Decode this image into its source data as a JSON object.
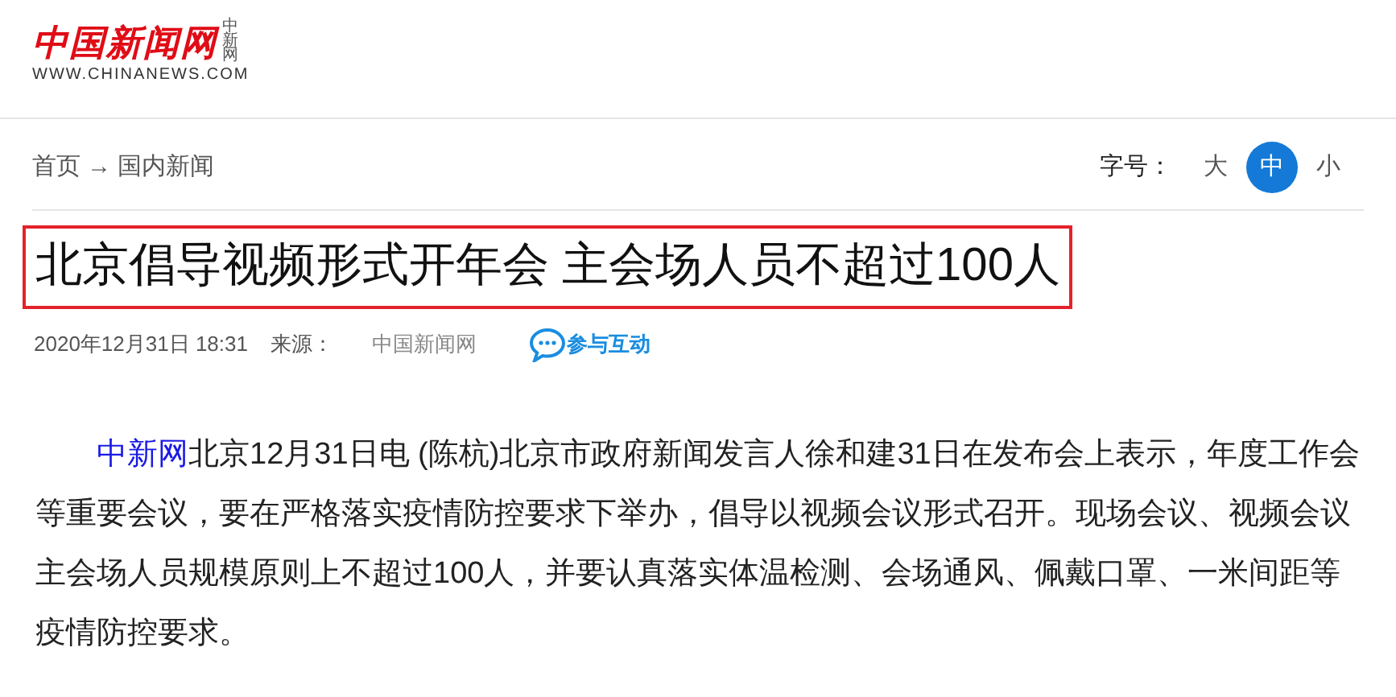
{
  "logo": {
    "name": "中国新闻网",
    "side_text": "中新网",
    "url": "WWW.CHINANEWS.COM"
  },
  "breadcrumb": {
    "home": "首页",
    "separator": "→",
    "section": "国内新闻"
  },
  "font_size": {
    "label": "字号：",
    "options": [
      {
        "label": "大",
        "selected": false
      },
      {
        "label": "中",
        "selected": true
      },
      {
        "label": "小",
        "selected": false
      }
    ]
  },
  "headline": "北京倡导视频形式开年会 主会场人员不超过100人",
  "meta": {
    "date": "2020年12月31日 18:31",
    "source_label": "来源：",
    "source": "中国新闻网",
    "interact": "参与互动"
  },
  "article": {
    "source_link": "中新网",
    "text": "北京12月31日电 (陈杭)北京市政府新闻发言人徐和建31日在发布会上表示，年度工作会等重要会议，要在严格落实疫情防控要求下举办，倡导以视频会议形式召开。现场会议、视频会议主会场人员规模原则上不超过100人，并要认真落实体温检测、会场通风、佩戴口罩、一米间距等疫情防控要求。"
  }
}
